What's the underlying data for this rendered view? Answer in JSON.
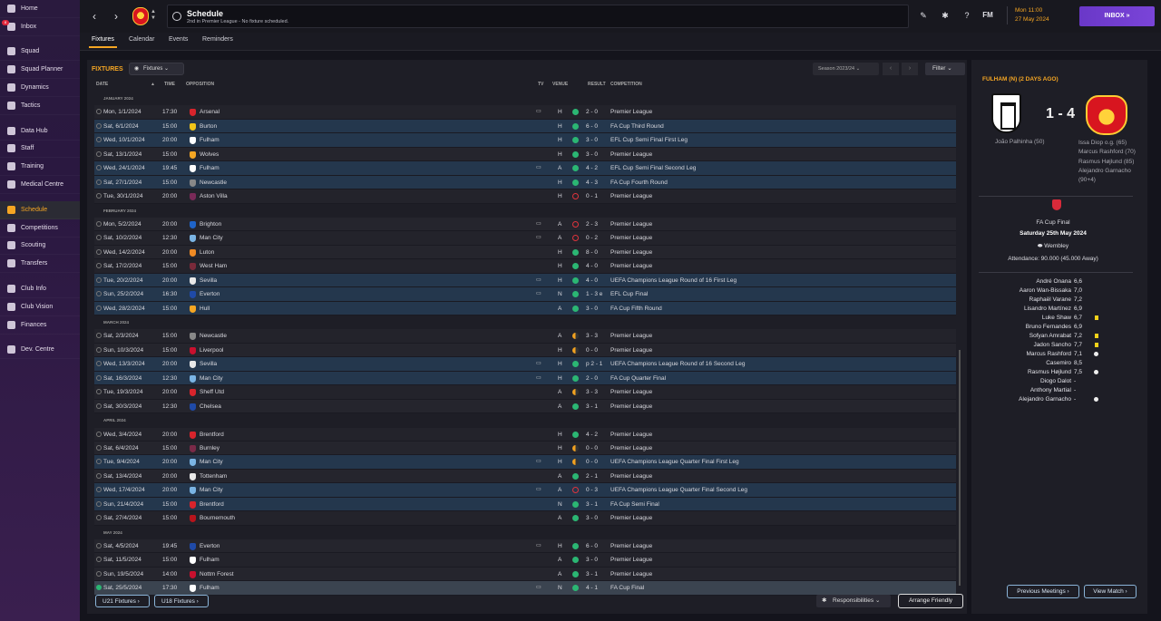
{
  "sidebar": {
    "inbox_badge": "8",
    "items": [
      "Home",
      "Inbox",
      "Squad",
      "Squad Planner",
      "Dynamics",
      "Tactics",
      "Data Hub",
      "Staff",
      "Training",
      "Medical Centre",
      "Schedule",
      "Competitions",
      "Scouting",
      "Transfers",
      "Club Info",
      "Club Vision",
      "Finances",
      "Dev. Centre"
    ]
  },
  "header": {
    "title": "Schedule",
    "subtitle": "2nd in Premier League - No fixture scheduled.",
    "fm_label": "FM",
    "time": "Mon 11:00",
    "date": "27 May 2024",
    "inbox_label": "INBOX"
  },
  "tabs": [
    "Fixtures",
    "Calendar",
    "Events",
    "Reminders"
  ],
  "fixtures": {
    "heading": "FIXTURES",
    "filter_dropdown": "Fixtures",
    "season": "Season 2023/24",
    "filter_label": "Filter",
    "columns": {
      "date": "DATE",
      "time": "TIME",
      "opposition": "OPPOSITION",
      "tv": "TV",
      "venue": "VENUE",
      "result": "RESULT",
      "competition": "COMPETITION"
    },
    "rows": [
      {
        "month": "JANUARY 2024"
      },
      {
        "date": "Mon, 1/1/2024",
        "time": "17:30",
        "opp": "Arsenal",
        "tv": true,
        "venue": "H",
        "result": "2 - 0",
        "outcome": "W",
        "comp": "Premier League",
        "hl": false,
        "c": "#d8242c"
      },
      {
        "date": "Sat, 6/1/2024",
        "time": "15:00",
        "opp": "Burton",
        "tv": false,
        "venue": "H",
        "result": "6 - 0",
        "outcome": "W",
        "comp": "FA Cup Third Round",
        "hl": true,
        "c": "#f0c419"
      },
      {
        "date": "Wed, 10/1/2024",
        "time": "20:00",
        "opp": "Fulham",
        "tv": false,
        "venue": "H",
        "result": "3 - 0",
        "outcome": "W",
        "comp": "EFL Cup Semi Final First Leg",
        "hl": true,
        "c": "#ffffff"
      },
      {
        "date": "Sat, 13/1/2024",
        "time": "15:00",
        "opp": "Wolves",
        "tv": false,
        "venue": "H",
        "result": "3 - 0",
        "outcome": "W",
        "comp": "Premier League",
        "hl": false,
        "c": "#f5a623"
      },
      {
        "date": "Wed, 24/1/2024",
        "time": "19:45",
        "opp": "Fulham",
        "tv": true,
        "venue": "A",
        "result": "4 - 2",
        "outcome": "W",
        "comp": "EFL Cup Semi Final Second Leg",
        "hl": true,
        "c": "#ffffff"
      },
      {
        "date": "Sat, 27/1/2024",
        "time": "15:00",
        "opp": "Newcastle",
        "tv": false,
        "venue": "H",
        "result": "4 - 3",
        "outcome": "W",
        "comp": "FA Cup Fourth Round",
        "hl": true,
        "c": "#888888"
      },
      {
        "date": "Tue, 30/1/2024",
        "time": "20:00",
        "opp": "Aston Villa",
        "tv": false,
        "venue": "H",
        "result": "0 - 1",
        "outcome": "L",
        "comp": "Premier League",
        "hl": false,
        "c": "#7a2a58"
      },
      {
        "month": "FEBRUARY 2024"
      },
      {
        "date": "Mon, 5/2/2024",
        "time": "20:00",
        "opp": "Brighton",
        "tv": true,
        "venue": "A",
        "result": "2 - 3",
        "outcome": "L",
        "comp": "Premier League",
        "hl": false,
        "c": "#1f64c8"
      },
      {
        "date": "Sat, 10/2/2024",
        "time": "12:30",
        "opp": "Man City",
        "tv": true,
        "venue": "A",
        "result": "0 - 2",
        "outcome": "L",
        "comp": "Premier League",
        "hl": false,
        "c": "#7ab4e4"
      },
      {
        "date": "Wed, 14/2/2024",
        "time": "20:00",
        "opp": "Luton",
        "tv": false,
        "venue": "H",
        "result": "8 - 0",
        "outcome": "W",
        "comp": "Premier League",
        "hl": false,
        "c": "#f08a24"
      },
      {
        "date": "Sat, 17/2/2024",
        "time": "15:00",
        "opp": "West Ham",
        "tv": false,
        "venue": "H",
        "result": "4 - 0",
        "outcome": "W",
        "comp": "Premier League",
        "hl": false,
        "c": "#7a2a3a"
      },
      {
        "date": "Tue, 20/2/2024",
        "time": "20:00",
        "opp": "Sevilla",
        "tv": true,
        "venue": "H",
        "result": "4 - 0",
        "outcome": "W",
        "comp": "UEFA Champions League Round of 16  First Leg",
        "hl": true,
        "c": "#e8e8e8"
      },
      {
        "date": "Sun, 25/2/2024",
        "time": "16:30",
        "opp": "Everton",
        "tv": true,
        "venue": "N",
        "result": "1 - 3 e",
        "outcome": "W",
        "comp": "EFL Cup Final",
        "hl": true,
        "c": "#1f4aa8"
      },
      {
        "date": "Wed, 28/2/2024",
        "time": "15:00",
        "opp": "Hull",
        "tv": false,
        "venue": "A",
        "result": "3 - 0",
        "outcome": "W",
        "comp": "FA Cup Fifth Round",
        "hl": true,
        "c": "#f5a623"
      },
      {
        "month": "MARCH 2024"
      },
      {
        "date": "Sat, 2/3/2024",
        "time": "15:00",
        "opp": "Newcastle",
        "tv": false,
        "venue": "A",
        "result": "3 - 3",
        "outcome": "D",
        "comp": "Premier League",
        "hl": false,
        "c": "#888888"
      },
      {
        "date": "Sun, 10/3/2024",
        "time": "15:00",
        "opp": "Liverpool",
        "tv": false,
        "venue": "H",
        "result": "0 - 0",
        "outcome": "D",
        "comp": "Premier League",
        "hl": false,
        "c": "#c8102e"
      },
      {
        "date": "Wed, 13/3/2024",
        "time": "20:00",
        "opp": "Sevilla",
        "tv": true,
        "venue": "H",
        "result": "p 2 - 1",
        "outcome": "W",
        "comp": "UEFA Champions League Round of 16  Second Leg",
        "hl": true,
        "c": "#e8e8e8"
      },
      {
        "date": "Sat, 16/3/2024",
        "time": "12:30",
        "opp": "Man City",
        "tv": true,
        "venue": "H",
        "result": "2 - 0",
        "outcome": "W",
        "comp": "FA Cup Quarter Final",
        "hl": true,
        "c": "#7ab4e4"
      },
      {
        "date": "Tue, 19/3/2024",
        "time": "20:00",
        "opp": "Sheff Utd",
        "tv": false,
        "venue": "A",
        "result": "3 - 3",
        "outcome": "D",
        "comp": "Premier League",
        "hl": false,
        "c": "#d8242c"
      },
      {
        "date": "Sat, 30/3/2024",
        "time": "12:30",
        "opp": "Chelsea",
        "tv": false,
        "venue": "A",
        "result": "3 - 1",
        "outcome": "W",
        "comp": "Premier League",
        "hl": false,
        "c": "#1f4aa8"
      },
      {
        "month": "APRIL 2024"
      },
      {
        "date": "Wed, 3/4/2024",
        "time": "20:00",
        "opp": "Brentford",
        "tv": false,
        "venue": "H",
        "result": "4 - 2",
        "outcome": "W",
        "comp": "Premier League",
        "hl": false,
        "c": "#d8242c"
      },
      {
        "date": "Sat, 6/4/2024",
        "time": "15:00",
        "opp": "Burnley",
        "tv": false,
        "venue": "H",
        "result": "0 - 0",
        "outcome": "D",
        "comp": "Premier League",
        "hl": false,
        "c": "#7a2a48"
      },
      {
        "date": "Tue, 9/4/2024",
        "time": "20:00",
        "opp": "Man City",
        "tv": true,
        "venue": "H",
        "result": "0 - 0",
        "outcome": "D",
        "comp": "UEFA Champions League Quarter Final First Leg",
        "hl": true,
        "c": "#7ab4e4"
      },
      {
        "date": "Sat, 13/4/2024",
        "time": "20:00",
        "opp": "Tottenham",
        "tv": false,
        "venue": "A",
        "result": "2 - 1",
        "outcome": "W",
        "comp": "Premier League",
        "hl": false,
        "c": "#e8e8e8"
      },
      {
        "date": "Wed, 17/4/2024",
        "time": "20:00",
        "opp": "Man City",
        "tv": true,
        "venue": "A",
        "result": "0 - 3",
        "outcome": "L",
        "comp": "UEFA Champions League Quarter Final Second Leg",
        "hl": true,
        "c": "#7ab4e4"
      },
      {
        "date": "Sun, 21/4/2024",
        "time": "15:00",
        "opp": "Brentford",
        "tv": false,
        "venue": "N",
        "result": "3 - 1",
        "outcome": "W",
        "comp": "FA Cup Semi Final",
        "hl": true,
        "c": "#d8242c"
      },
      {
        "date": "Sat, 27/4/2024",
        "time": "15:00",
        "opp": "Bournemouth",
        "tv": false,
        "venue": "A",
        "result": "3 - 0",
        "outcome": "W",
        "comp": "Premier League",
        "hl": false,
        "c": "#b8141c"
      },
      {
        "month": "MAY 2024"
      },
      {
        "date": "Sat, 4/5/2024",
        "time": "19:45",
        "opp": "Everton",
        "tv": true,
        "venue": "H",
        "result": "6 - 0",
        "outcome": "W",
        "comp": "Premier League",
        "hl": false,
        "c": "#1f4aa8"
      },
      {
        "date": "Sat, 11/5/2024",
        "time": "15:00",
        "opp": "Fulham",
        "tv": false,
        "venue": "A",
        "result": "3 - 0",
        "outcome": "W",
        "comp": "Premier League",
        "hl": false,
        "c": "#ffffff"
      },
      {
        "date": "Sun, 19/5/2024",
        "time": "14:00",
        "opp": "Nottm Forest",
        "tv": false,
        "venue": "A",
        "result": "3 - 1",
        "outcome": "W",
        "comp": "Premier League",
        "hl": false,
        "c": "#c8102e"
      },
      {
        "date": "Sat, 25/5/2024",
        "time": "17:30",
        "opp": "Fulham",
        "tv": true,
        "venue": "N",
        "result": "4 - 1",
        "outcome": "W",
        "comp": "FA Cup Final",
        "hl": false,
        "sel": true,
        "c": "#ffffff"
      }
    ],
    "u21_label": "U21 Fixtures",
    "u18_label": "U18 Fixtures",
    "responsibilities_label": "Responsibilities",
    "arrange_label": "Arrange Friendly"
  },
  "match": {
    "title": "FULHAM (N) (2 DAYS AGO)",
    "score": "1 - 4",
    "home_scorers": [
      "João Palhinha (50)"
    ],
    "away_scorers": [
      "Issa Diop o.g. (65)",
      "Marcus Rashford (70)",
      "Rasmus Højlund (85)",
      "Alejandro Garnacho",
      "(90+4)"
    ],
    "competition": "FA Cup Final",
    "date": "Saturday 25th May 2024",
    "venue": "Wembley",
    "attendance": "Attendance: 90.000 (45.000 Away)",
    "lineup": [
      {
        "name": "André Onana",
        "rating": "6,6",
        "event": ""
      },
      {
        "name": "Aaron Wan-Bissaka",
        "rating": "7,0",
        "event": ""
      },
      {
        "name": "Raphaël Varane",
        "rating": "7,2",
        "event": ""
      },
      {
        "name": "Lisandro Martínez",
        "rating": "6,9",
        "event": ""
      },
      {
        "name": "Luke Shaw",
        "rating": "6,7",
        "event": "yellow"
      },
      {
        "name": "Bruno Fernandes",
        "rating": "6,9",
        "event": ""
      },
      {
        "name": "Sofyan Amrabat",
        "rating": "7,2",
        "event": "yellow"
      },
      {
        "name": "Jadon Sancho",
        "rating": "7,7",
        "event": "yellow"
      },
      {
        "name": "Marcus Rashford",
        "rating": "7,1",
        "event": "goal"
      },
      {
        "name": "Casemiro",
        "rating": "8,5",
        "event": ""
      },
      {
        "name": "Rasmus Højlund",
        "rating": "7,5",
        "event": "goal"
      },
      {
        "name": "Diogo Dalot",
        "rating": "-",
        "event": ""
      },
      {
        "name": "Anthony Martial",
        "rating": "-",
        "event": ""
      },
      {
        "name": "Alejandro Garnacho",
        "rating": "-",
        "event": "goal"
      }
    ],
    "prev_label": "Previous Meetings",
    "view_label": "View Match"
  },
  "colors": {
    "accent": "#f5a623",
    "win": "#2bb673",
    "loss": "#e0343c",
    "draw": "#f0a020",
    "highlight_row": "#24374d"
  }
}
